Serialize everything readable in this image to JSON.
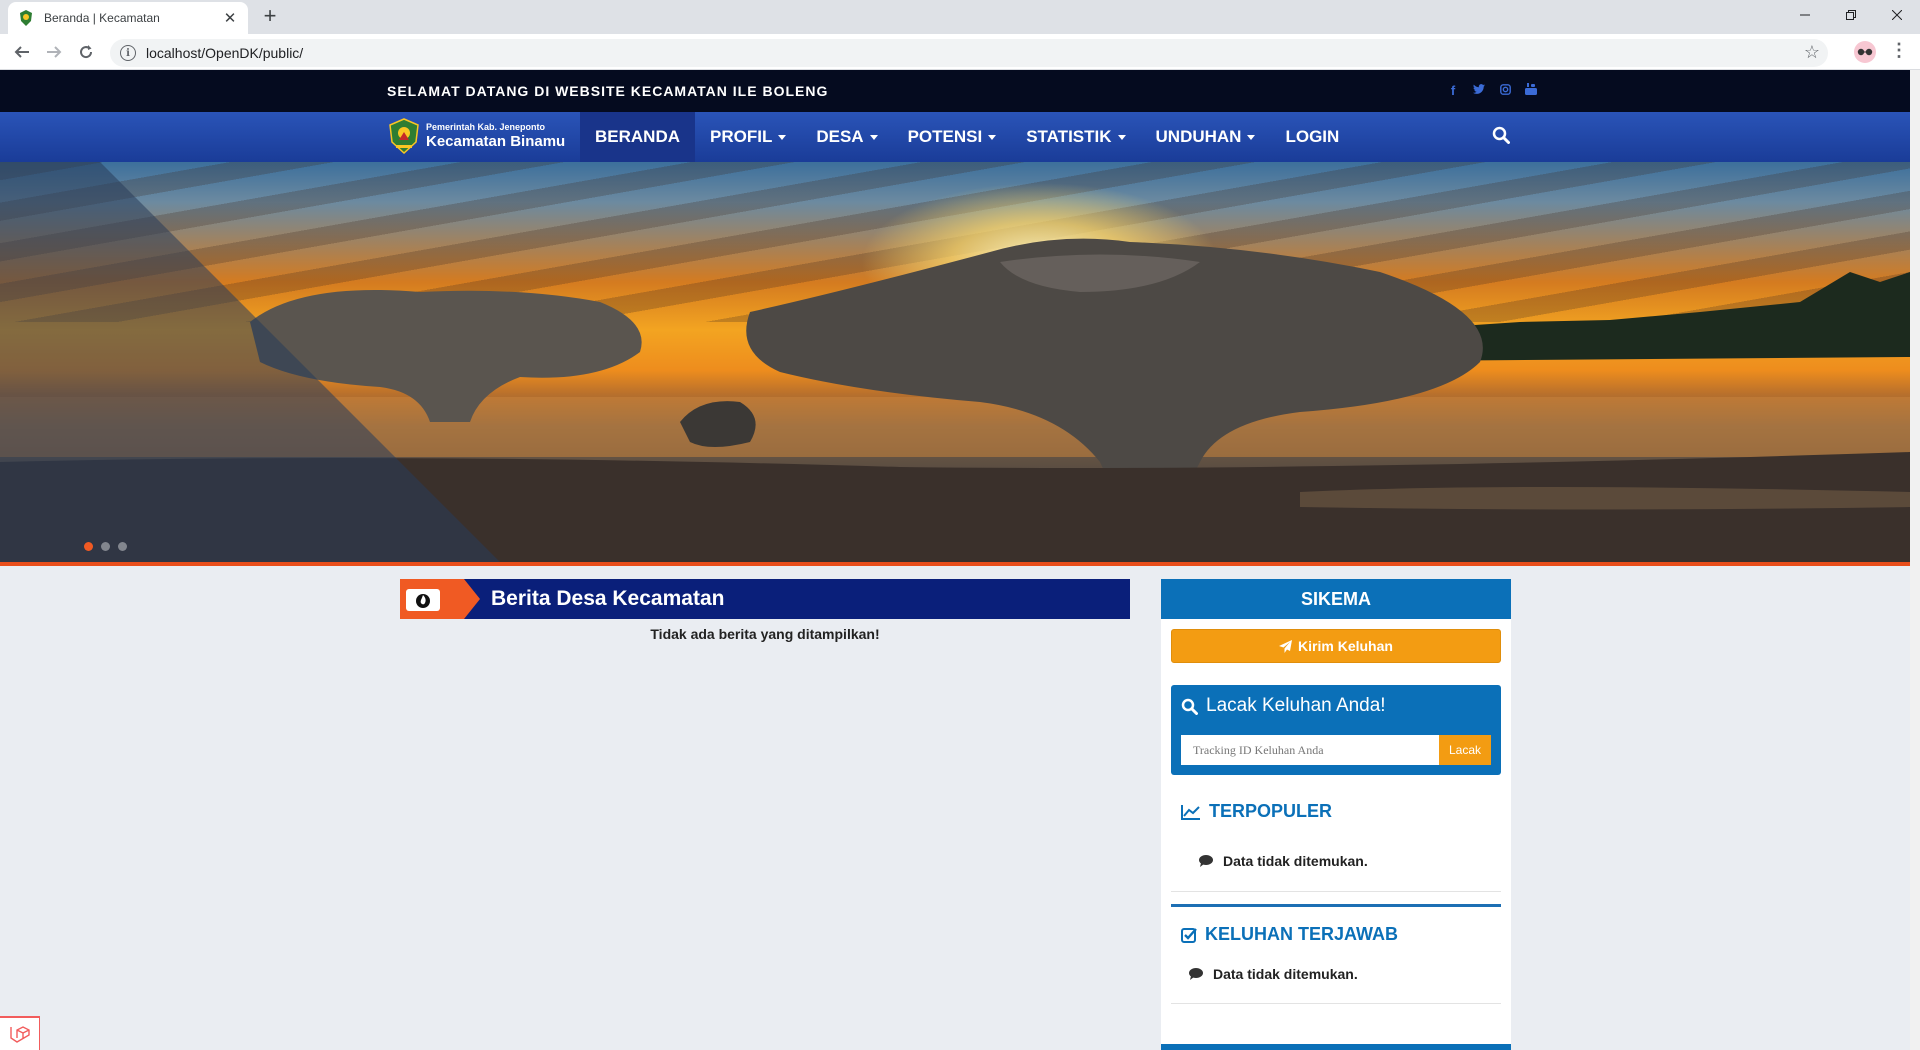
{
  "browser": {
    "tab_title": "Beranda | Kecamatan",
    "url": "localhost/OpenDK/public/",
    "new_tab_label": "+",
    "close_label": "✕"
  },
  "topbar": {
    "welcome": "SELAMAT DATANG DI WEBSITE KECAMATAN ILE BOLENG",
    "socials": [
      "facebook-icon",
      "twitter-icon",
      "instagram-icon",
      "youtube-icon"
    ]
  },
  "logo": {
    "small": "Pemerintah Kab. Jeneponto",
    "big": "Kecamatan Binamu"
  },
  "menu": {
    "items": [
      {
        "label": "BERANDA",
        "active": true,
        "dropdown": false
      },
      {
        "label": "PROFIL",
        "active": false,
        "dropdown": true
      },
      {
        "label": "DESA",
        "active": false,
        "dropdown": true
      },
      {
        "label": "POTENSI",
        "active": false,
        "dropdown": true
      },
      {
        "label": "STATISTIK",
        "active": false,
        "dropdown": true
      },
      {
        "label": "UNDUHAN",
        "active": false,
        "dropdown": true
      },
      {
        "label": "LOGIN",
        "active": false,
        "dropdown": false
      }
    ]
  },
  "hero": {
    "slide_count": 3,
    "active_slide": 1
  },
  "news": {
    "title": "Berita Desa Kecamatan",
    "empty": "Tidak ada berita yang ditampilkan!"
  },
  "sikema": {
    "header": "SIKEMA",
    "kirim_label": "Kirim Keluhan",
    "lacak_title": "Lacak Keluhan Anda!",
    "lacak_placeholder": "Tracking ID Keluhan Anda",
    "lacak_button": "Lacak",
    "terpopuler_title": "TERPOPULER",
    "terpopuler_empty": "Data tidak ditemukan.",
    "terjawab_title": "KELUHAN TERJAWAB",
    "terjawab_empty": "Data tidak ditemukan."
  },
  "colors": {
    "topbar": "#050b1f",
    "navbar": "#2a54b8",
    "accent_orange": "#f05a23",
    "sikema_blue": "#0b70b8",
    "button_orange": "#f39c12"
  }
}
